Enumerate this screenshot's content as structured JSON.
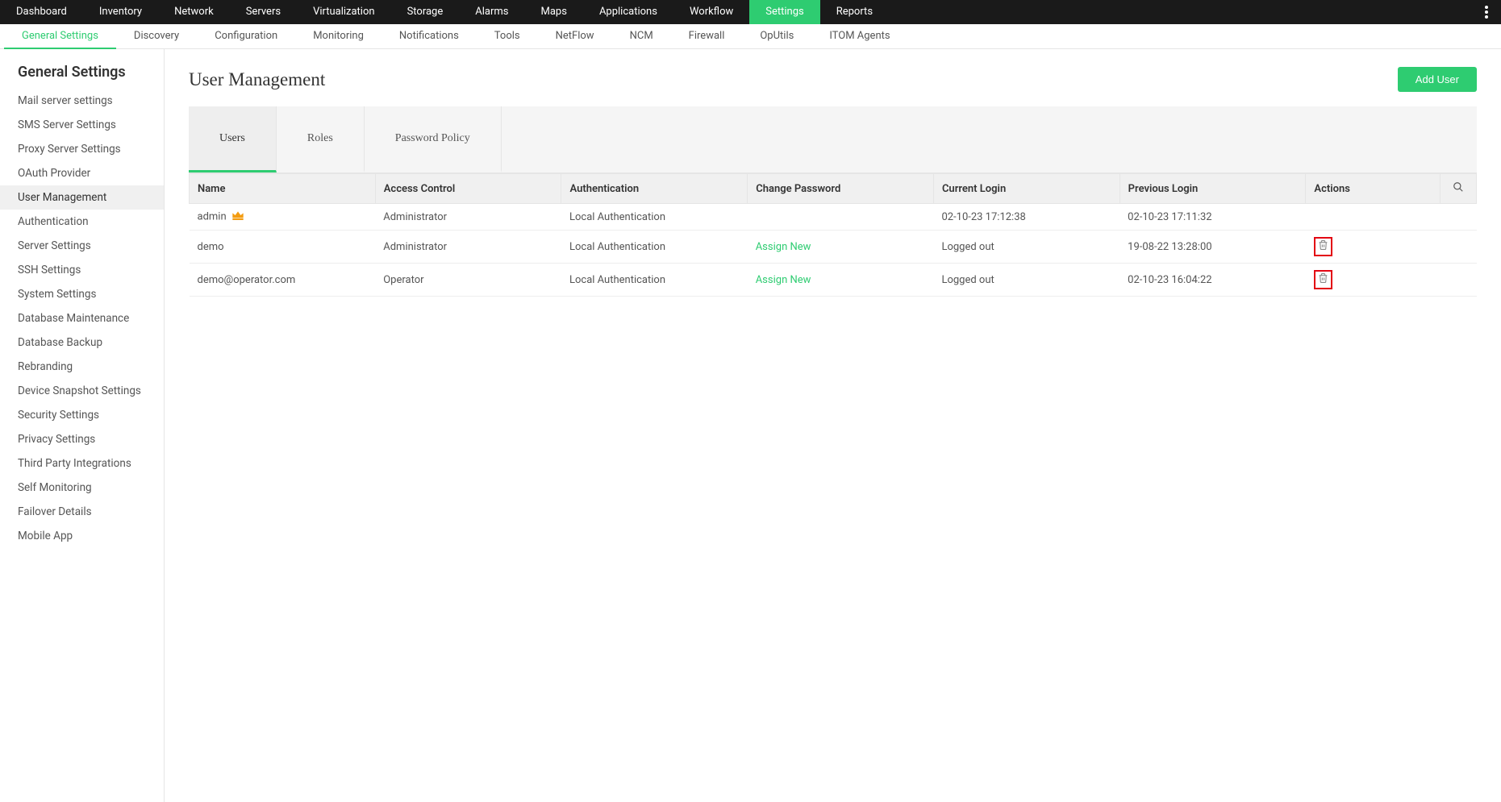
{
  "top_nav": {
    "items": [
      "Dashboard",
      "Inventory",
      "Network",
      "Servers",
      "Virtualization",
      "Storage",
      "Alarms",
      "Maps",
      "Applications",
      "Workflow",
      "Settings",
      "Reports"
    ],
    "active_index": 10
  },
  "sub_nav": {
    "items": [
      "General Settings",
      "Discovery",
      "Configuration",
      "Monitoring",
      "Notifications",
      "Tools",
      "NetFlow",
      "NCM",
      "Firewall",
      "OpUtils",
      "ITOM Agents"
    ],
    "active_index": 0
  },
  "sidebar": {
    "title": "General Settings",
    "items": [
      "Mail server settings",
      "SMS Server Settings",
      "Proxy Server Settings",
      "OAuth Provider",
      "User Management",
      "Authentication",
      "Server Settings",
      "SSH Settings",
      "System Settings",
      "Database Maintenance",
      "Database Backup",
      "Rebranding",
      "Device Snapshot Settings",
      "Security Settings",
      "Privacy Settings",
      "Third Party Integrations",
      "Self Monitoring",
      "Failover Details",
      "Mobile App"
    ],
    "active_index": 4
  },
  "page": {
    "title": "User Management",
    "add_button": "Add User"
  },
  "tabs": {
    "items": [
      "Users",
      "Roles",
      "Password Policy"
    ],
    "active_index": 0
  },
  "table": {
    "columns": [
      "Name",
      "Access Control",
      "Authentication",
      "Change Password",
      "Current Login",
      "Previous Login",
      "Actions"
    ],
    "rows": [
      {
        "name": "admin",
        "is_admin": true,
        "access_control": "Administrator",
        "authentication": "Local Authentication",
        "change_password": "",
        "current_login": "02-10-23 17:12:38",
        "previous_login": "02-10-23 17:11:32",
        "show_delete": false
      },
      {
        "name": "demo",
        "is_admin": false,
        "access_control": "Administrator",
        "authentication": "Local Authentication",
        "change_password": "Assign New",
        "current_login": "Logged out",
        "previous_login": "19-08-22 13:28:00",
        "show_delete": true
      },
      {
        "name": "demo@operator.com",
        "is_admin": false,
        "access_control": "Operator",
        "authentication": "Local Authentication",
        "change_password": "Assign New",
        "current_login": "Logged out",
        "previous_login": "02-10-23 16:04:22",
        "show_delete": true
      }
    ]
  }
}
